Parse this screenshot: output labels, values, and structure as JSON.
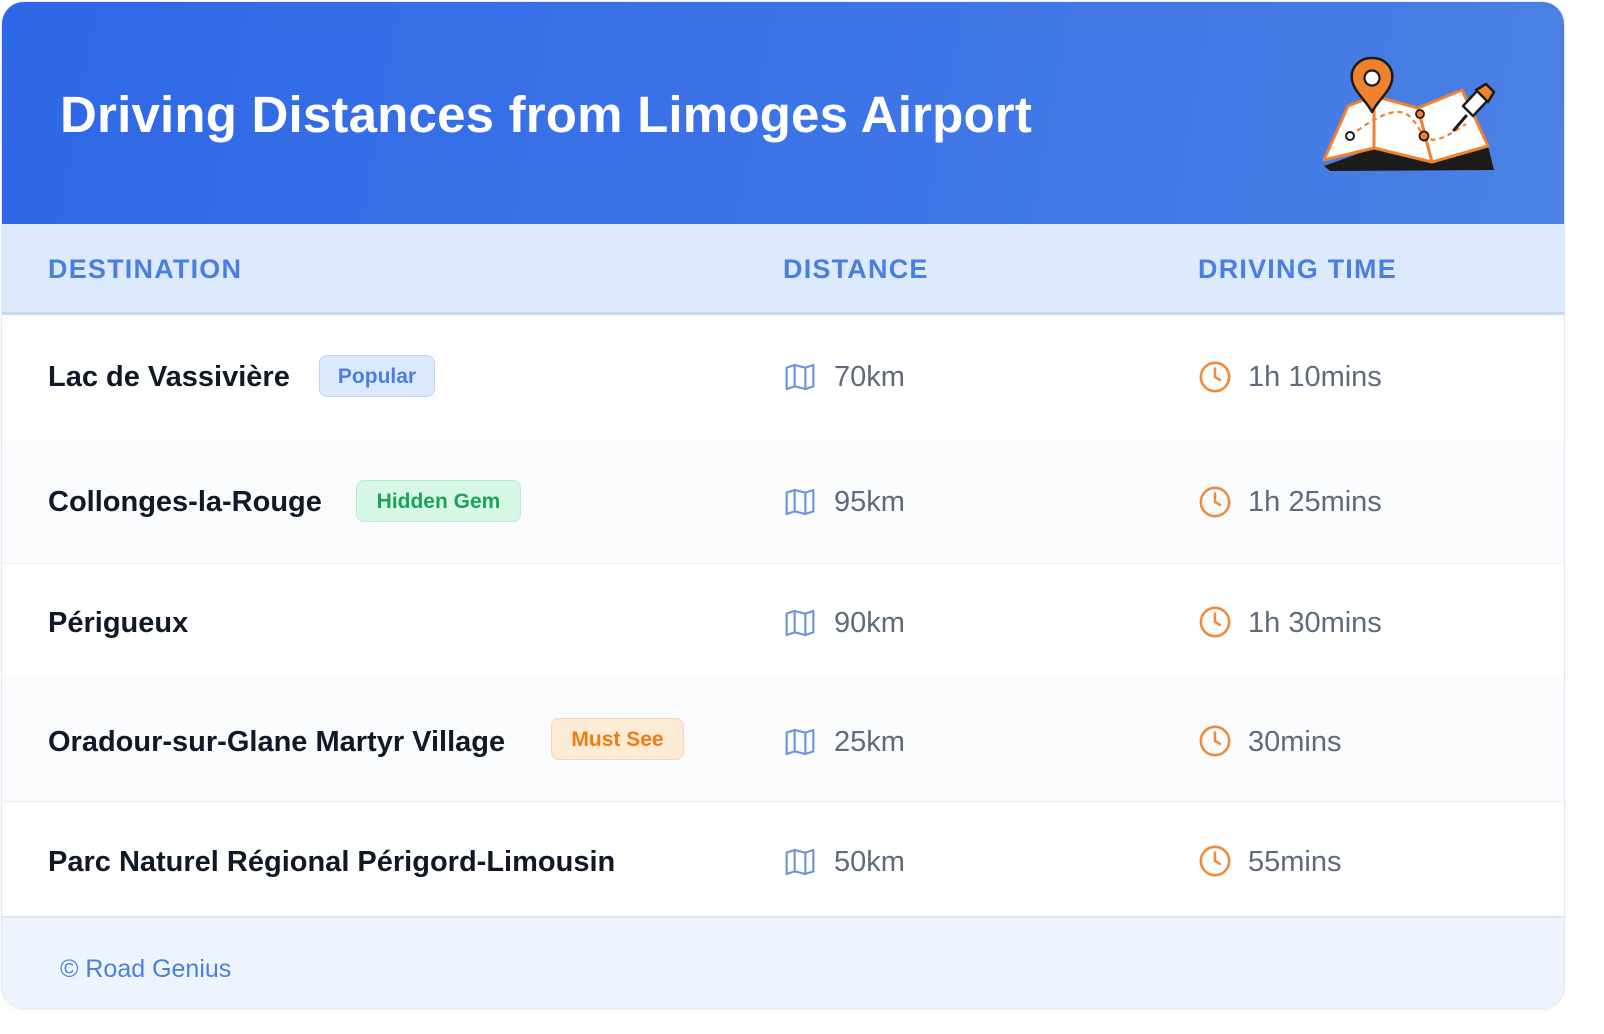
{
  "header": {
    "title": "Driving Distances from Limoges Airport",
    "icon": "map-pin-icon"
  },
  "table": {
    "columns": [
      "DESTINATION",
      "DISTANCE",
      "DRIVING TIME"
    ],
    "rows": [
      {
        "destination": "Lac de Vassivière",
        "badge": "Popular",
        "distance": "70km",
        "time": "1h 10mins"
      },
      {
        "destination": "Collonges-la-Rouge",
        "badge": "Hidden Gem",
        "distance": "95km",
        "time": "1h 25mins"
      },
      {
        "destination": "Périgueux",
        "badge": "",
        "distance": "90km",
        "time": "1h 30mins"
      },
      {
        "destination": "Oradour-sur-Glane Martyr Village",
        "badge": "Must See",
        "distance": "25km",
        "time": "30mins"
      },
      {
        "destination": "Parc Naturel Régional Périgord-Limousin",
        "badge": "",
        "distance": "50km",
        "time": "55mins"
      }
    ],
    "icons": {
      "distance": "map-icon",
      "time": "clock-icon"
    }
  },
  "footer": {
    "credit": "© Road Genius"
  },
  "colors": {
    "header_gradient_start": "#2f68e6",
    "header_gradient_end": "#4b80e4",
    "accent_blue": "#4a7fe0",
    "accent_orange": "#ef8a3c",
    "badge_popular": "#4a7fe0",
    "badge_hidden_gem": "#1aa35a",
    "badge_must_see": "#ef7d12"
  }
}
